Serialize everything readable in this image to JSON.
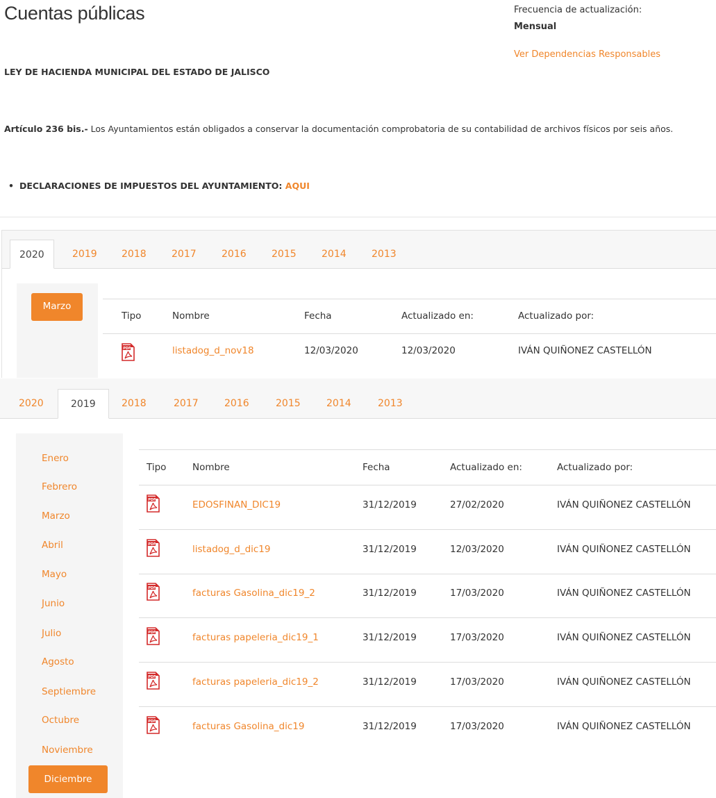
{
  "header": {
    "title": "Cuentas públicas",
    "frequency_label": "Frecuencia de actualización:",
    "frequency_value": "Mensual",
    "dependencies_link": "Ver Dependencias Responsables"
  },
  "law_title": "LEY DE HACIENDA MUNICIPAL DEL ESTADO DE JALISCO",
  "article": {
    "label": "Artículo 236 bis.-",
    "text": " Los Ayuntamientos están obligados a conservar la documentación comprobatoria de su contabilidad de archivos físicos por seis años."
  },
  "declarations": {
    "bullet": "•",
    "label": "DECLARACIONES DE IMPUESTOS DEL AYUNTAMIENTO:",
    "link": "AQUI"
  },
  "colors": {
    "accent": "#f0862b",
    "tab_bar": "#f7f7f7",
    "sidebar": "#f5f5f5"
  },
  "panel_2020": {
    "tabs": [
      "2020",
      "2019",
      "2018",
      "2017",
      "2016",
      "2015",
      "2014",
      "2013"
    ],
    "active_tab": "2020",
    "months": [
      "Marzo"
    ],
    "active_month": "Marzo",
    "columns": [
      "Tipo",
      "Nombre",
      "Fecha",
      "Actualizado en:",
      "Actualizado por:"
    ],
    "rows": [
      {
        "icon": "pdf-icon",
        "name": "listadog_d_nov18",
        "date": "12/03/2020",
        "updated_on": "12/03/2020",
        "updated_by": "IVÁN QUIÑONEZ CASTELLÓN"
      }
    ]
  },
  "panel_2019": {
    "tabs": [
      "2020",
      "2019",
      "2018",
      "2017",
      "2016",
      "2015",
      "2014",
      "2013"
    ],
    "active_tab": "2019",
    "months": [
      "Enero",
      "Febrero",
      "Marzo",
      "Abril",
      "Mayo",
      "Junio",
      "Julio",
      "Agosto",
      "Septiembre",
      "Octubre",
      "Noviembre",
      "Diciembre"
    ],
    "active_month": "Diciembre",
    "columns": [
      "Tipo",
      "Nombre",
      "Fecha",
      "Actualizado en:",
      "Actualizado por:"
    ],
    "rows": [
      {
        "icon": "pdf-icon",
        "name": "EDOSFINAN_DIC19",
        "date": "31/12/2019",
        "updated_on": "27/02/2020",
        "updated_by": "IVÁN QUIÑONEZ CASTELLÓN"
      },
      {
        "icon": "pdf-icon",
        "name": "listadog_d_dic19",
        "date": "31/12/2019",
        "updated_on": "12/03/2020",
        "updated_by": "IVÁN QUIÑONEZ CASTELLÓN"
      },
      {
        "icon": "pdf-icon",
        "name": "facturas Gasolina_dic19_2",
        "date": "31/12/2019",
        "updated_on": "17/03/2020",
        "updated_by": "IVÁN QUIÑONEZ CASTELLÓN"
      },
      {
        "icon": "pdf-icon",
        "name": "facturas papeleria_dic19_1",
        "date": "31/12/2019",
        "updated_on": "17/03/2020",
        "updated_by": "IVÁN QUIÑONEZ CASTELLÓN"
      },
      {
        "icon": "pdf-icon",
        "name": "facturas papeleria_dic19_2",
        "date": "31/12/2019",
        "updated_on": "17/03/2020",
        "updated_by": "IVÁN QUIÑONEZ CASTELLÓN"
      },
      {
        "icon": "pdf-icon",
        "name": "facturas Gasolina_dic19",
        "date": "31/12/2019",
        "updated_on": "17/03/2020",
        "updated_by": "IVÁN QUIÑONEZ CASTELLÓN"
      }
    ]
  }
}
